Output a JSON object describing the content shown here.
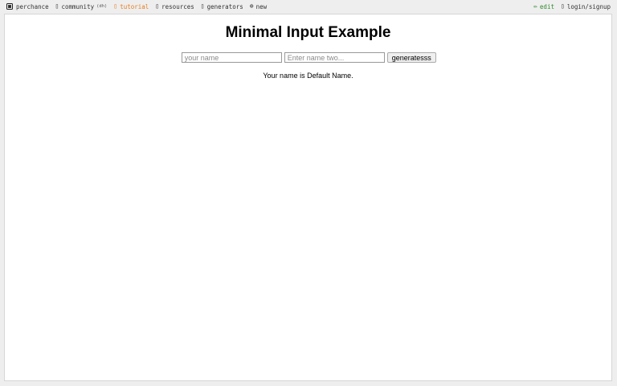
{
  "topbar": {
    "brand": "perchance",
    "community": "community",
    "community_note": "(dh)",
    "tutorial": "tutorial",
    "resources": "resources",
    "generators": "generators",
    "new": "new",
    "edit": "edit",
    "login": "login/signup"
  },
  "icons": {
    "community": "chat-bubble-icon",
    "tutorial": "book-icon",
    "resources": "link-icon",
    "generators": "grid-icon",
    "new": "plus-circle-icon",
    "edit": "pencil-icon",
    "login": "user-icon"
  },
  "colors": {
    "tutorial": "#e67e22",
    "edit": "#2e8b2e"
  },
  "page": {
    "title": "Minimal Input Example",
    "name_input": {
      "value": "",
      "placeholder": "your name"
    },
    "name_two_input": {
      "value": "",
      "placeholder": "Enter name two..."
    },
    "generate_button": "generatesss",
    "output": "Your name is Default Name."
  }
}
